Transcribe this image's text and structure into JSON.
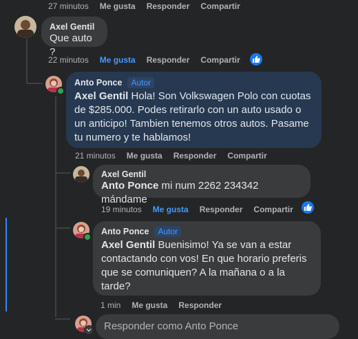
{
  "c0": {
    "time": "27 minutos",
    "like": "Me gusta",
    "reply": "Responder",
    "share": "Compartir"
  },
  "c1": {
    "author": "Axel Gentil",
    "text": "Que auto ?",
    "time": "22 minutos",
    "like": "Me gusta",
    "reply": "Responder",
    "share": "Compartir",
    "liked": true,
    "reaction_icon": "thumbs-up-icon"
  },
  "c2": {
    "author": "Anto Ponce",
    "badge": "Autor",
    "mention": "Axel Gentil",
    "text": " Hola! Son Volkswagen Polo con cuotas de $285.000. Podes retirarlo con un auto usado o un anticipo! Tambien tenemos otros autos. Pasame tu numero y te hablamos!",
    "time": "21 minutos",
    "like": "Me gusta",
    "reply": "Responder",
    "share": "Compartir"
  },
  "c3": {
    "author": "Axel Gentil",
    "mention": "Anto Ponce",
    "text": " mi num 2262 234342 mándame",
    "time": "19 minutos",
    "like": "Me gusta",
    "reply": "Responder",
    "share": "Compartir",
    "liked": true,
    "reaction_icon": "thumbs-up-icon"
  },
  "c4": {
    "author": "Anto Ponce",
    "badge": "Autor",
    "mention": "Axel Gentil",
    "text": " Buenisimo! Ya se van a estar contactando con vos! En que horario preferis que se comuniquen? A la mañana o a la tarde?",
    "time": "1 min",
    "like": "Me gusta",
    "reply": "Responder"
  },
  "reply_box": {
    "placeholder": "Responder como Anto Ponce"
  },
  "colors": {
    "accent": "#4599ff",
    "author_bubble": "#263951",
    "bubble": "#3a3b3c",
    "background": "#242526"
  }
}
